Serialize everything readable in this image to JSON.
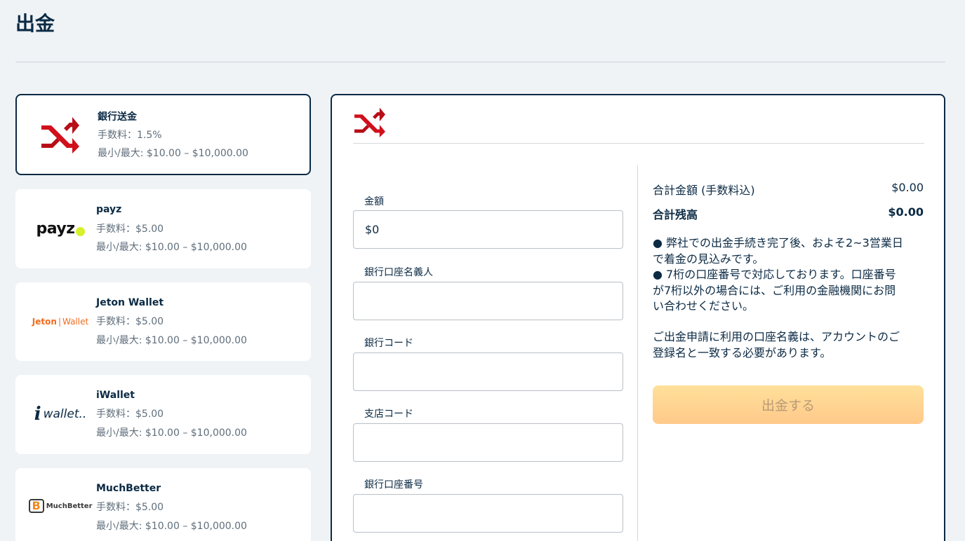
{
  "page": {
    "title": "出金"
  },
  "methods": [
    {
      "name": "銀行送金",
      "fee": "手数料：1.5%",
      "limit": "最小/最大: $10.00 – $10,000.00",
      "logo": "bank-transfer-icon"
    },
    {
      "name": "payz",
      "fee": "手数料：$5.00",
      "limit": "最小/最大: $10.00 – $10,000.00",
      "logo_text": "payz"
    },
    {
      "name": "Jeton Wallet",
      "fee": "手数料：$5.00",
      "limit": "最小/最大: $10.00 – $10,000.00",
      "logo_text_a": "Jeton",
      "logo_text_b": "Wallet"
    },
    {
      "name": "iWallet",
      "fee": "手数料：$5.00",
      "limit": "最小/最大: $10.00 – $10,000.00",
      "logo_text_a": "i",
      "logo_text_b": "wallet.."
    },
    {
      "name": "MuchBetter",
      "fee": "手数料：$5.00",
      "limit": "最小/最大: $10.00 – $10,000.00",
      "logo_text": "MuchBetter"
    }
  ],
  "form": {
    "amount_label": "金額",
    "amount_value": "$0",
    "holder_label": "銀行口座名義人",
    "bank_code_label": "銀行コード",
    "branch_code_label": "支店コード",
    "account_number_label": "銀行口座番号"
  },
  "summary": {
    "total_label": "合計金額 (手数料込)",
    "total_value": "$0.00",
    "balance_label": "合計残高",
    "balance_value": "$0.00",
    "note1_line1": "● 弊社での出金手続き完了後、およそ2~3営業日",
    "note1_line2": "で着金の見込みです。",
    "note2_line1": "● 7桁の口座番号で対応しております。口座番号",
    "note2_line2": "が7桁以外の場合には、ご利用の金融機関にお問",
    "note2_line3": "い合わせください。",
    "note3_line1": "ご出金申請に利用の口座名義は、アカウントのご",
    "note3_line2": "登録名と一致する必要があります。",
    "submit_label": "出金する"
  },
  "colors": {
    "accent": "#0b2a44",
    "bank_icon": "#d0101b",
    "payz_dot": "#d6f02a",
    "jeton": "#f26b1d",
    "submit_bg": "#ffd694"
  }
}
